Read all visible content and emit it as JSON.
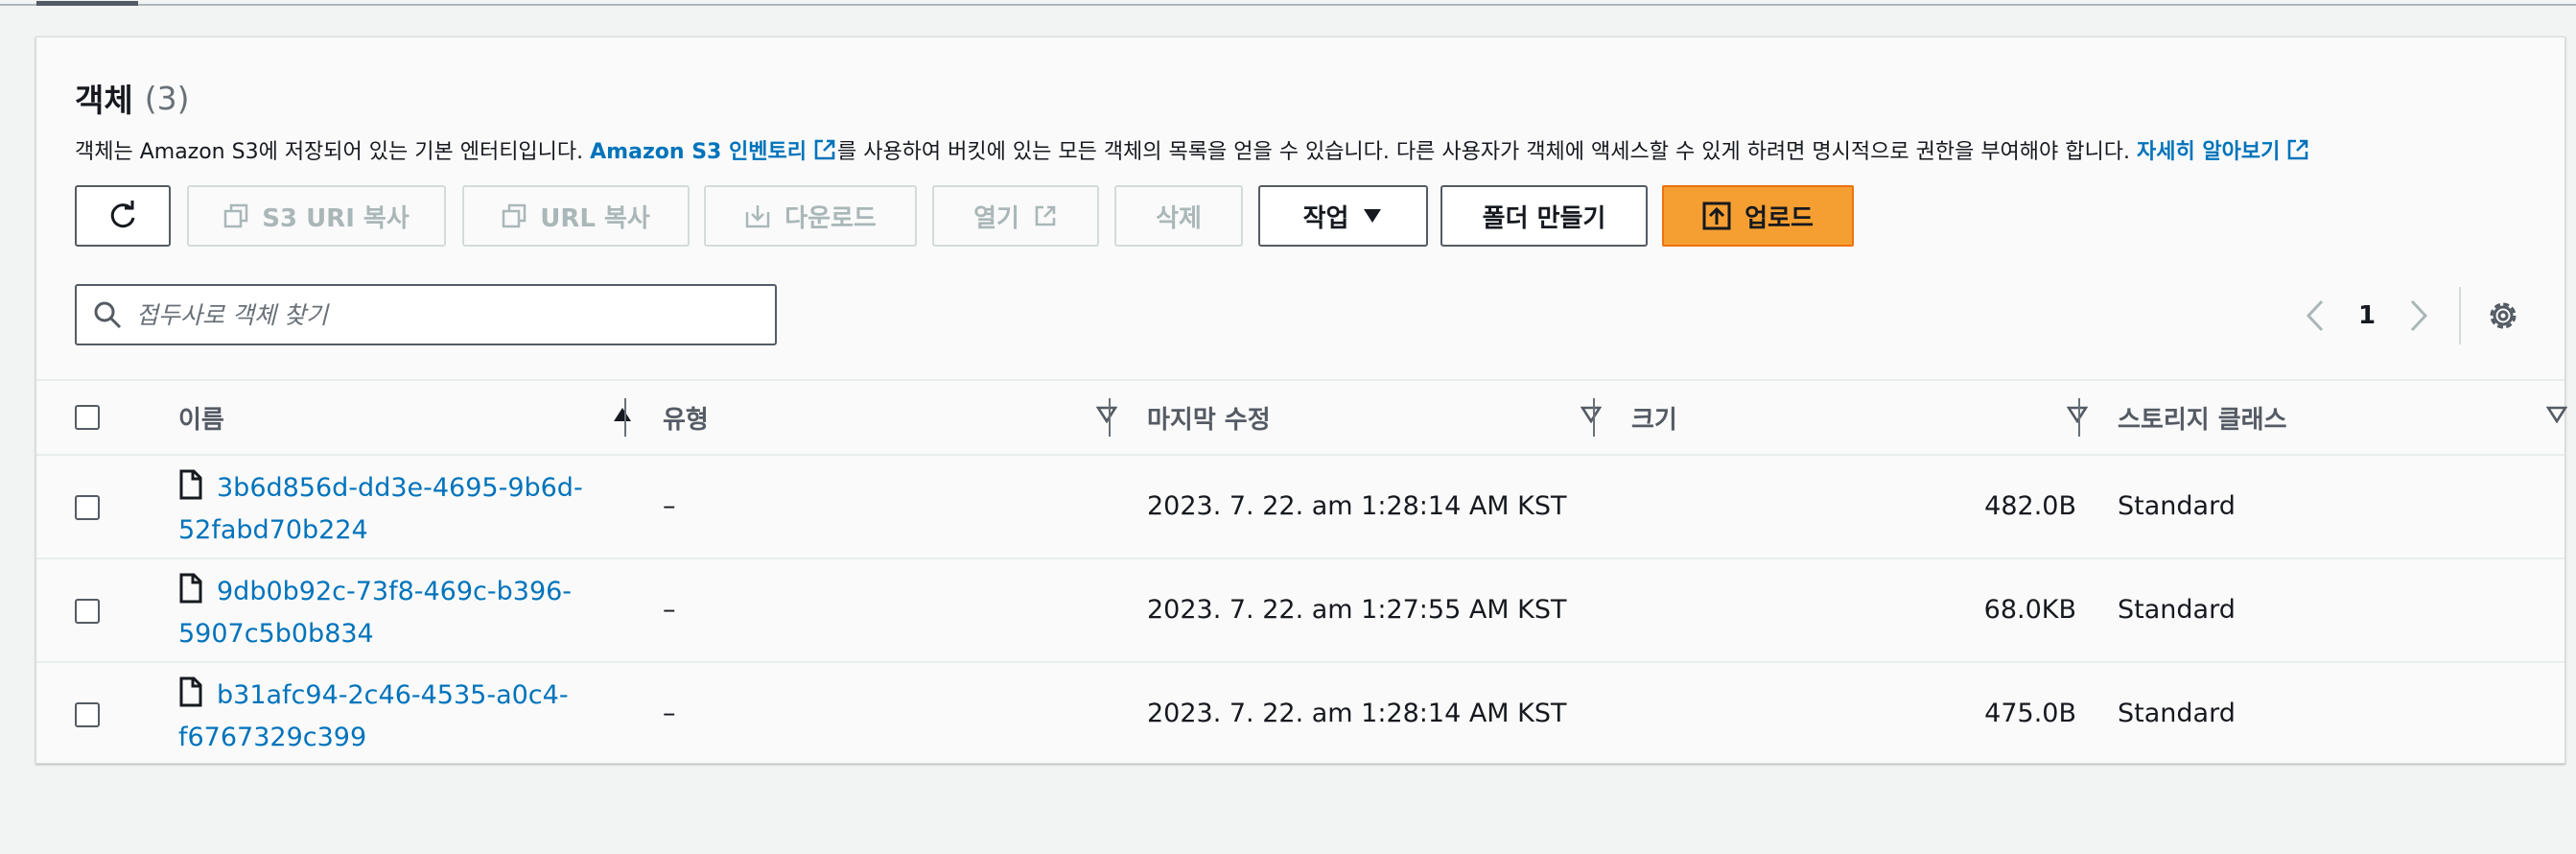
{
  "header": {
    "title": "객체",
    "count": "(3)",
    "description_prefix": "객체는 Amazon S3에 저장되어 있는 기본 엔터티입니다.",
    "inventory_link": "Amazon S3 인벤토리",
    "description_middle": "를 사용하여 버킷에 있는 모든 객체의 목록을 얻을 수 있습니다. 다른 사용자가 객체에 액세스할 수 있게 하려면 명시적으로 권한을 부여해야 합니다.",
    "learn_more_link": "자세히 알아보기"
  },
  "toolbar": {
    "refresh_icon": "refresh-icon",
    "copy_s3_uri": "S3 URI 복사",
    "copy_url": "URL 복사",
    "download": "다운로드",
    "open": "열기",
    "delete": "삭제",
    "actions": "작업",
    "create_folder": "폴더 만들기",
    "upload": "업로드"
  },
  "search": {
    "placeholder": "접두사로 객체 찾기",
    "value": ""
  },
  "pagination": {
    "current_page": "1"
  },
  "table": {
    "columns": [
      "이름",
      "유형",
      "마지막 수정",
      "크기",
      "스토리지 클래스"
    ],
    "rows": [
      {
        "name_line1": "3b6d856d-dd3e-4695-9b6d-",
        "name_line2": "52fabd70b224",
        "type": "–",
        "modified": "2023. 7. 22. am 1:28:14 AM KST",
        "size": "482.0B",
        "storage_class": "Standard"
      },
      {
        "name_line1": "9db0b92c-73f8-469c-b396-",
        "name_line2": "5907c5b0b834",
        "type": "–",
        "modified": "2023. 7. 22. am 1:27:55 AM KST",
        "size": "68.0KB",
        "storage_class": "Standard"
      },
      {
        "name_line1": "b31afc94-2c46-4535-a0c4-",
        "name_line2": "f6767329c399",
        "type": "–",
        "modified": "2023. 7. 22. am 1:28:14 AM KST",
        "size": "475.0B",
        "storage_class": "Standard"
      }
    ]
  },
  "colors": {
    "link": "#0073bb",
    "primary_button": "#f59f32",
    "disabled_text": "#aab7b8"
  }
}
